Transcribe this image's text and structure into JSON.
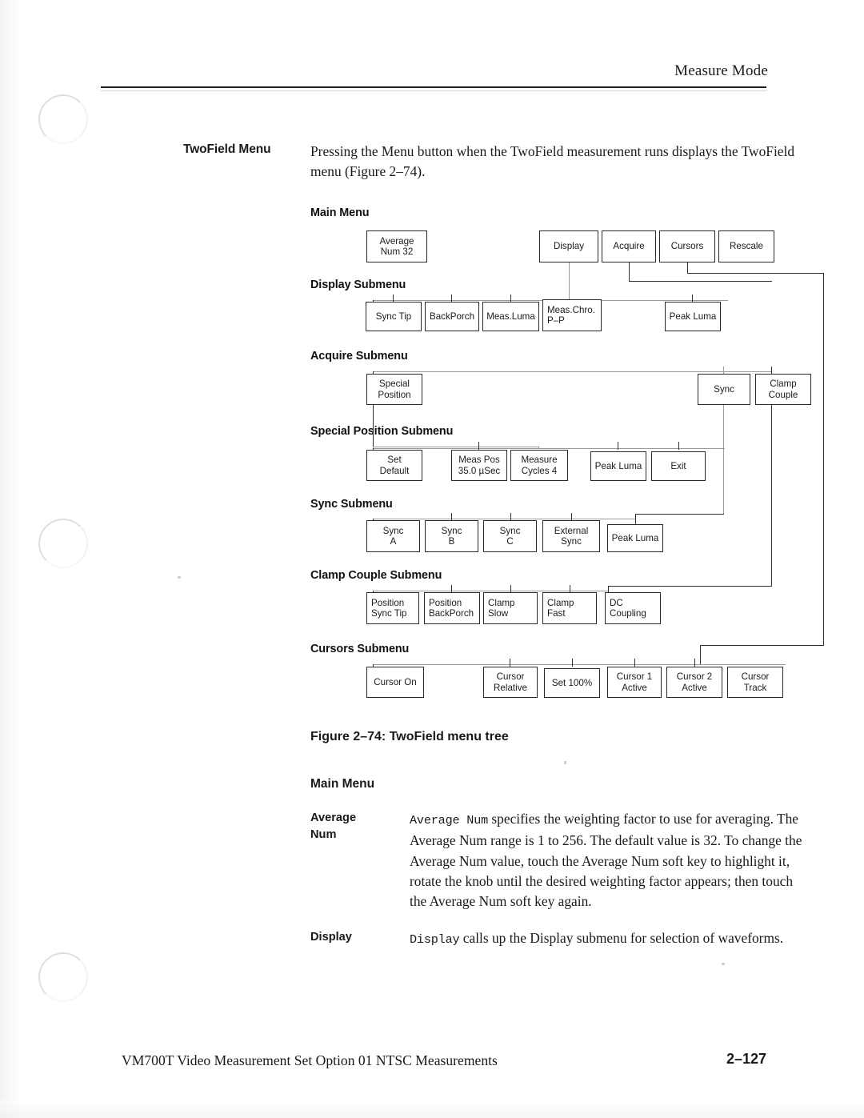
{
  "header": {
    "running_head": "Measure Mode"
  },
  "intro": {
    "side_heading": "TwoField Menu",
    "body": "Pressing the Menu button when the TwoField measurement runs displays the TwoField menu (Figure 2–74)."
  },
  "figure": {
    "caption": "Figure 2–74: TwoField menu tree",
    "sections": [
      {
        "label": "Main Menu"
      },
      {
        "label": "Display Submenu"
      },
      {
        "label": "Acquire Submenu"
      },
      {
        "label": "Special Position Submenu"
      },
      {
        "label": "Sync Submenu"
      },
      {
        "label": "Clamp Couple Submenu"
      },
      {
        "label": "Cursors Submenu"
      }
    ],
    "nodes": {
      "main": [
        {
          "l1": "Average",
          "l2": "Num 32"
        },
        {
          "l1": "Display",
          "l2": ""
        },
        {
          "l1": "Acquire",
          "l2": ""
        },
        {
          "l1": "Cursors",
          "l2": ""
        },
        {
          "l1": "Rescale",
          "l2": ""
        }
      ],
      "display": [
        {
          "l1": "Sync Tip",
          "l2": ""
        },
        {
          "l1": "BackPorch",
          "l2": ""
        },
        {
          "l1": "Meas.Luma",
          "l2": ""
        },
        {
          "l1": "Meas.Chro.",
          "l2": "P–P"
        },
        {
          "l1": "Peak Luma",
          "l2": ""
        }
      ],
      "acquire": [
        {
          "l1": "Special",
          "l2": "Position"
        },
        {
          "l1": "Sync",
          "l2": ""
        },
        {
          "l1": "Clamp",
          "l2": "Couple"
        }
      ],
      "special_position": [
        {
          "l1": "Set",
          "l2": "Default"
        },
        {
          "l1": "Meas Pos",
          "l2": "35.0 µSec"
        },
        {
          "l1": "Measure",
          "l2": "Cycles 4"
        },
        {
          "l1": "Peak Luma",
          "l2": ""
        },
        {
          "l1": "Exit",
          "l2": ""
        }
      ],
      "sync": [
        {
          "l1": "Sync",
          "l2": "A"
        },
        {
          "l1": "Sync",
          "l2": "B"
        },
        {
          "l1": "Sync",
          "l2": "C"
        },
        {
          "l1": "External",
          "l2": "Sync"
        },
        {
          "l1": "Peak Luma",
          "l2": ""
        }
      ],
      "clamp_couple": [
        {
          "l1": "Position",
          "l2": "Sync Tip"
        },
        {
          "l1": "Position",
          "l2": "BackPorch"
        },
        {
          "l1": "Clamp",
          "l2": "Slow"
        },
        {
          "l1": "Clamp",
          "l2": "Fast"
        },
        {
          "l1": "DC",
          "l2": "Coupling"
        }
      ],
      "cursors": [
        {
          "l1": "Cursor On",
          "l2": ""
        },
        {
          "l1": "Cursor",
          "l2": "Relative"
        },
        {
          "l1": "Set 100%",
          "l2": ""
        },
        {
          "l1": "Cursor 1",
          "l2": "Active"
        },
        {
          "l1": "Cursor 2",
          "l2": "Active"
        },
        {
          "l1": "Cursor",
          "l2": "Track"
        }
      ]
    }
  },
  "description": {
    "heading": "Main Menu",
    "entries": [
      {
        "term_line1": "Average",
        "term_line2": "Num",
        "code": "Average Num",
        "text": " specifies the weighting factor to use for averaging. The Average Num range is 1 to 256. The default value is 32. To change the Average Num value, touch the Average Num soft key to highlight it, rotate the knob until the desired weighting factor appears; then touch the Average Num soft key again."
      },
      {
        "term_line1": "Display",
        "term_line2": "",
        "code": "Display",
        "text": " calls up the Display submenu for selection of waveforms."
      }
    ]
  },
  "footer": {
    "text": "VM700T Video Measurement Set Option 01 NTSC Measurements",
    "page": "2–127"
  }
}
